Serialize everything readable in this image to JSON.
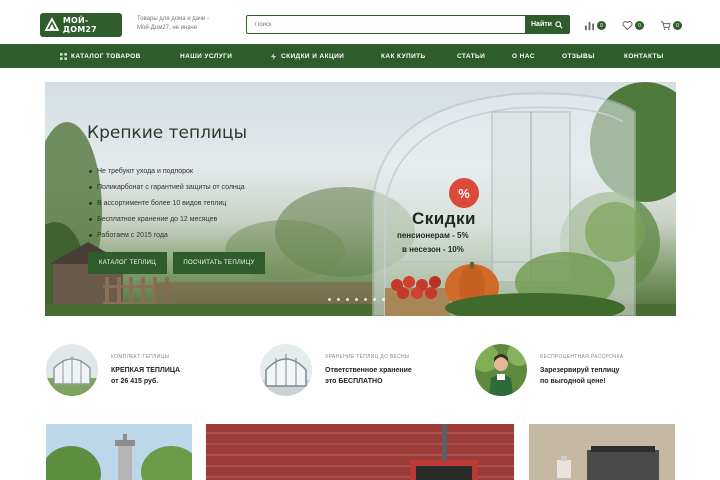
{
  "header": {
    "logo_text": "МОЙ-ДОМ27",
    "tagline_line1": "Товары для дома и дачи -",
    "tagline_line2": "Мой-Дом27, не иначе",
    "search_placeholder": "Поиск",
    "search_button": "Найти",
    "compare_count": "0",
    "favorites_count": "0",
    "cart_count": "0"
  },
  "nav": {
    "catalog": "КАТАЛОГ ТОВАРОВ",
    "services": "НАШИ УСЛУГИ",
    "sales": "СКИДКИ И АКЦИИ",
    "how_to_buy": "КАК КУПИТЬ",
    "articles": "СТАТЬИ",
    "about": "О НАС",
    "reviews": "ОТЗЫВЫ",
    "contacts": "КОНТАКТЫ"
  },
  "hero": {
    "title": "Крепкие теплицы",
    "bullets": [
      "Не требуют ухода и подпорок",
      "Поликарбонат с гарантией защиты от солнца",
      "В ассортименте более 10 видов теплиц",
      "Бесплатное хранение до 12 месяцев",
      "Работаем с 2015 года"
    ],
    "btn_catalog": "КАТАЛОГ ТЕПЛИЦ",
    "btn_calc": "ПОСЧИТАТЬ ТЕПЛИЦУ",
    "percent_sign": "%",
    "sale_title": "Скидки",
    "sale_line1": "пенсионерам - 5%",
    "sale_line2": "в несезон - 10%"
  },
  "features": [
    {
      "caption": "КОМПЛЕКТ ТЕПЛИЦЫ",
      "line1": "КРЕПКАЯ ТЕПЛИЦА",
      "line2": "от 26 415 руб."
    },
    {
      "caption": "ХРАНЕНИЕ ТЕПЛИЦ ДО ВЕСНЫ",
      "line1": "Ответственное хранение",
      "line2": "это БЕСПЛАТНО"
    },
    {
      "caption": "БЕСПРОЦЕНТНАЯ РАССРОЧКА",
      "line1": "Зарезервируй теплицу",
      "line2": "по выгодной цене!"
    }
  ],
  "colors": {
    "brand_green": "#2e5d2b",
    "sale_red": "#d94a3b"
  },
  "icons": [
    "logo-icon",
    "search-icon",
    "compare-icon",
    "heart-icon",
    "cart-icon",
    "grid-icon",
    "lightning-icon"
  ]
}
